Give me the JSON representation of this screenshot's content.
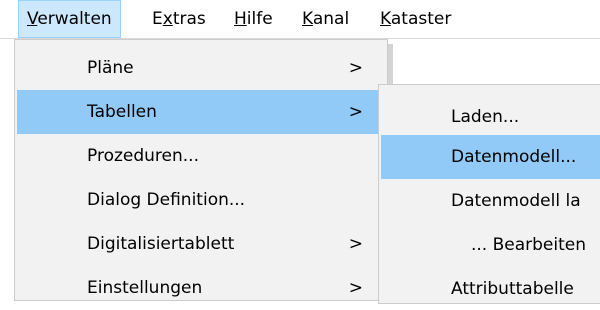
{
  "menubar": {
    "items": [
      {
        "label_pre": "",
        "mnemonic": "V",
        "label_post": "erwalten"
      },
      {
        "label_pre": "E",
        "mnemonic": "x",
        "label_post": "tras"
      },
      {
        "label_pre": "",
        "mnemonic": "H",
        "label_post": "ilfe"
      },
      {
        "label_pre": "",
        "mnemonic": "K",
        "label_post": "anal"
      },
      {
        "label_pre": "",
        "mnemonic": "K",
        "label_post": "ataster"
      }
    ]
  },
  "dropdown": {
    "items": [
      {
        "label": "Pläne",
        "arrow": ">"
      },
      {
        "label": "Tabellen",
        "arrow": ">"
      },
      {
        "label": "Prozeduren...",
        "arrow": ""
      },
      {
        "label": "Dialog Definition...",
        "arrow": ""
      },
      {
        "label": "Digitalisiertablett",
        "arrow": ">"
      },
      {
        "label": "Einstellungen",
        "arrow": ">"
      }
    ]
  },
  "submenu": {
    "items": [
      {
        "label": "Laden..."
      },
      {
        "label": "Datenmodell..."
      },
      {
        "label": "Datenmodell la"
      },
      {
        "label": "... Bearbeiten"
      },
      {
        "label": "Attributtabelle"
      }
    ]
  },
  "colors": {
    "highlight": "#91c9f7",
    "menu_bg": "#f2f2f2",
    "open_menu_bg": "#cce8ff"
  }
}
